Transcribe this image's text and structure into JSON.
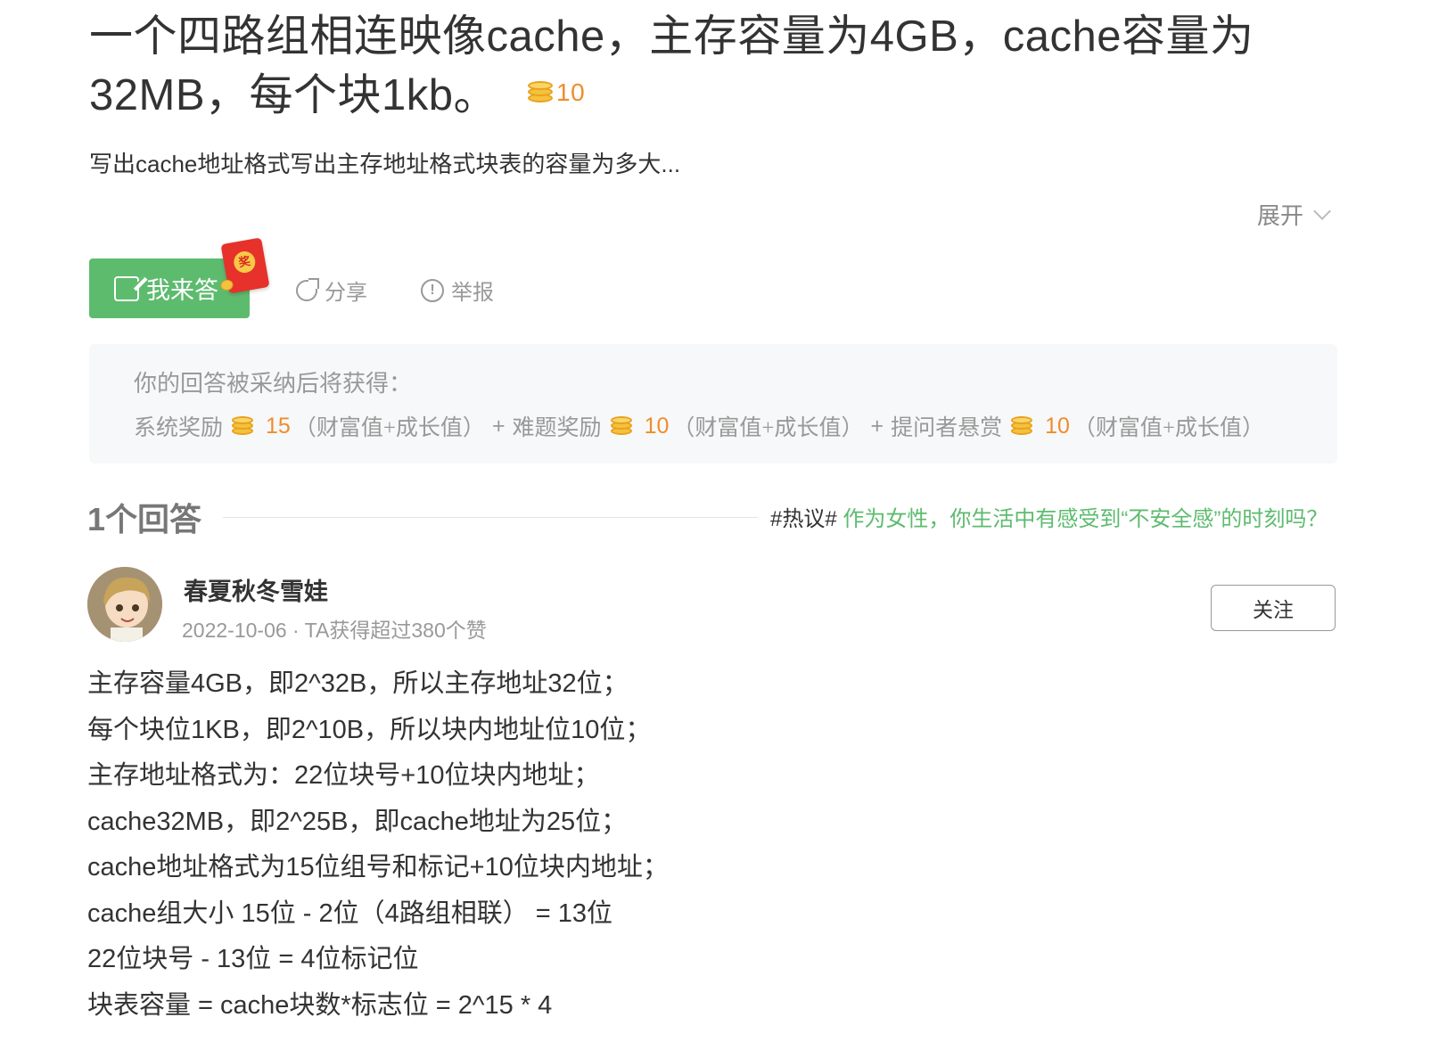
{
  "question": {
    "title": "一个四路组相连映像cache，主存容量为4GB，cache容量为32MB，每个块1kb。",
    "bounty": "10",
    "summary": "写出cache地址格式写出主存地址格式块表的容量为多大...",
    "expand_label": "展开"
  },
  "actions": {
    "answer_label": "我来答",
    "redpack_label": "奖",
    "share_label": "分享",
    "report_label": "举报"
  },
  "reward": {
    "title": "你的回答被采纳后将获得：",
    "items": [
      {
        "label": "系统奖励",
        "value": "15",
        "suffix": "（财富值+成长值）"
      },
      {
        "label": "难题奖励",
        "value": "10",
        "suffix": "（财富值+成长值）"
      },
      {
        "label": "提问者悬赏",
        "value": "10",
        "suffix": "（财富值+成长值）"
      }
    ],
    "plus": "+"
  },
  "answers_header": {
    "count_label": "1个回答",
    "hot_tag": "#热议#",
    "hot_text": "作为女性，你生活中有感受到“不安全感”的时刻吗？"
  },
  "answer": {
    "username": "春夏秋冬雪娃",
    "meta": "2022-10-06 · TA获得超过380个赞",
    "follow_label": "关注",
    "lines": [
      "主存容量4GB，即2^32B，所以主存地址32位；",
      "每个块位1KB，即2^10B，所以块内地址位10位；",
      "主存地址格式为：22位块号+10位块内地址；",
      "cache32MB，即2^25B，即cache地址为25位；",
      "cache地址格式为15位组号和标记+10位块内地址；",
      "cache组大小 15位 - 2位（4路组相联） = 13位",
      "22位块号 - 13位 = 4位标记位",
      "块表容量 = cache块数*标志位 = 2^15 * 4"
    ]
  },
  "colors": {
    "accent_green": "#5dbb6e",
    "coin_orange": "#f08c2b",
    "muted_gray": "#999999"
  }
}
